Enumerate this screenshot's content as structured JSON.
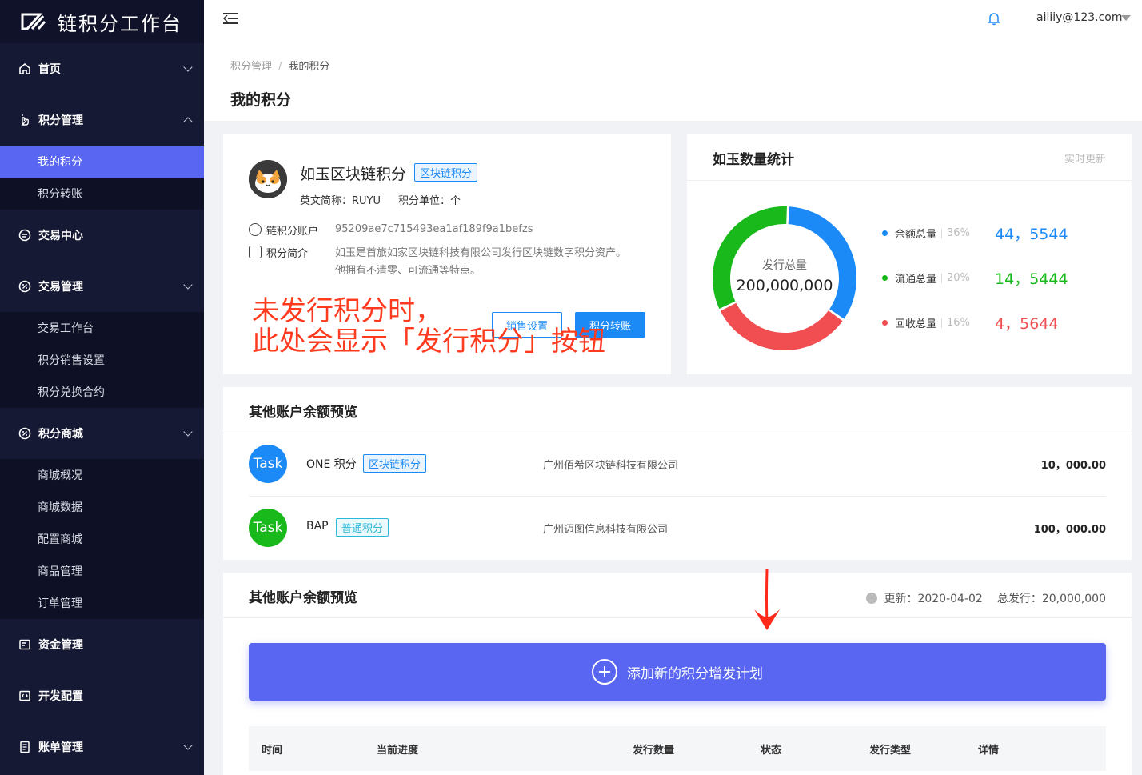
{
  "app": {
    "title": "链积分工作台"
  },
  "sidebar": {
    "groups": [
      {
        "label": "首页",
        "icon": "home-icon",
        "expanded": false
      },
      {
        "label": "积分管理",
        "icon": "hand-icon",
        "expanded": true,
        "items": [
          {
            "label": "我的积分",
            "active": true
          },
          {
            "label": "积分转账",
            "active": false
          }
        ]
      },
      {
        "label": "交易中心",
        "icon": "chat-icon",
        "expanded": false
      },
      {
        "label": "交易管理",
        "icon": "percent-icon",
        "expanded": true,
        "items": [
          {
            "label": "交易工作台"
          },
          {
            "label": "积分销售设置"
          },
          {
            "label": "积分兑换合约"
          }
        ]
      },
      {
        "label": "积分商城",
        "icon": "percent-icon",
        "expanded": true,
        "items": [
          {
            "label": "商城概况"
          },
          {
            "label": "商城数据"
          },
          {
            "label": "配置商城"
          },
          {
            "label": "商品管理"
          },
          {
            "label": "订单管理"
          }
        ]
      },
      {
        "label": "资金管理",
        "icon": "wallet-icon",
        "expanded": false
      },
      {
        "label": "开发配置",
        "icon": "code-icon",
        "expanded": false
      },
      {
        "label": "账单管理",
        "icon": "bill-icon",
        "expanded": false
      }
    ]
  },
  "header": {
    "user_email": "ailiiy@123.com"
  },
  "breadcrumb": {
    "parent": "积分管理",
    "sep": "/",
    "current": "我的积分"
  },
  "page": {
    "title": "我的积分"
  },
  "points": {
    "name": "如玉区块链积分",
    "tag": "区块链积分",
    "abbr": "英文简称：RUYU",
    "unit": "积分单位：个",
    "account_label": "链积分账户",
    "account_value": "95209ae7c715493ea1af189f9a1befzs",
    "intro_label": "积分简介",
    "intro_value": "如玉是首旅如家区块链科技有限公司发行区块链数字积分资产。他拥有不清零、可流通等特点。",
    "sales_btn": "销售设置",
    "transfer_btn": "积分转账",
    "annotation_line1": "未发行积分时，",
    "annotation_line2": "此处会显示「发行积分」按钮"
  },
  "stats": {
    "title": "如玉数量统计",
    "update": "实时更新",
    "center_label": "发行总量",
    "center_value": "200,000,000",
    "legend": [
      {
        "name": "余额总量",
        "pct": "36%",
        "value": "44，5544",
        "color": "#1b8af7"
      },
      {
        "name": "流通总量",
        "pct": "20%",
        "value": "14，5444",
        "color": "#19b81b"
      },
      {
        "name": "回收总量",
        "pct": "16%",
        "value": "4，5644",
        "color": "#f04e50"
      }
    ],
    "donut": [
      {
        "name": "余额总量",
        "fraction": 0.34,
        "color": "#1b8af7"
      },
      {
        "name": "回收总量",
        "fraction": 0.33,
        "color": "#f04e50"
      },
      {
        "name": "流通总量",
        "fraction": 0.33,
        "color": "#19b81b"
      }
    ]
  },
  "other_accounts": {
    "title": "其他账户余额预览",
    "rows": [
      {
        "avatar": "Task",
        "color": "#1b8af7",
        "name": "ONE 积分",
        "tag": "区块链积分",
        "tag_style": "blue",
        "company": "广州佰希区块链科技有限公司",
        "amount": "10，000.00"
      },
      {
        "avatar": "Task",
        "color": "#19b81b",
        "name": "BAP",
        "tag": "普通积分",
        "tag_style": "cyan",
        "company": "广州迈图信息科技有限公司",
        "amount": "100，000.00"
      }
    ]
  },
  "plans": {
    "title": "其他账户余额预览",
    "update": "更新：2020-04-02",
    "total": "总发行：20,000,000",
    "add_button": "添加新的积分增发计划",
    "columns": [
      "时间",
      "当前进度",
      "发行数量",
      "状态",
      "发行类型",
      "详情"
    ]
  }
}
